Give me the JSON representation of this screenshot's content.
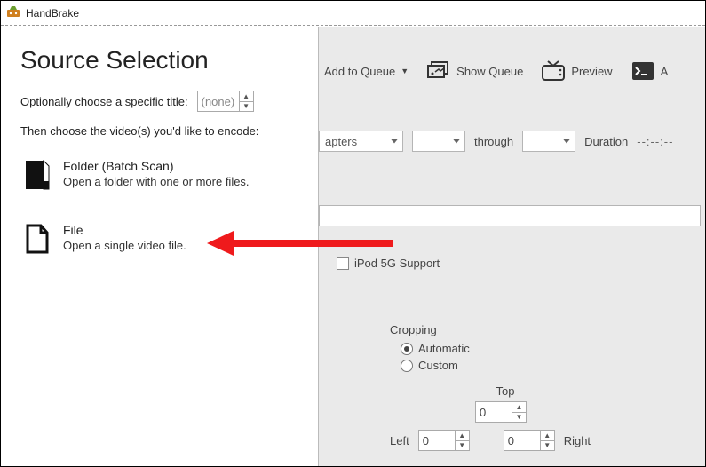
{
  "app": {
    "title": "HandBrake"
  },
  "panel": {
    "heading": "Source Selection",
    "optional_label": "Optionally choose a specific title:",
    "title_value": "(none)",
    "instruction": "Then choose the video(s) you'd like to encode:",
    "items": [
      {
        "title": "Folder (Batch Scan)",
        "sub": "Open a folder with one or more files."
      },
      {
        "title": "File",
        "sub": "Open a single video file."
      }
    ]
  },
  "toolbar": {
    "add_to_queue": "Add to Queue",
    "show_queue": "Show Queue",
    "preview": "Preview",
    "extra": "A"
  },
  "chapters": {
    "mode_label": "apters",
    "through": "through",
    "duration_label": "Duration",
    "duration_value": "--:--:--"
  },
  "ipod": {
    "label": "iPod 5G Support",
    "checked": false
  },
  "cropping": {
    "label": "Cropping",
    "automatic": "Automatic",
    "custom": "Custom",
    "selected": "automatic",
    "top_label": "Top",
    "left_label": "Left",
    "right_label": "Right",
    "top": "0",
    "left": "0",
    "right": "0"
  }
}
